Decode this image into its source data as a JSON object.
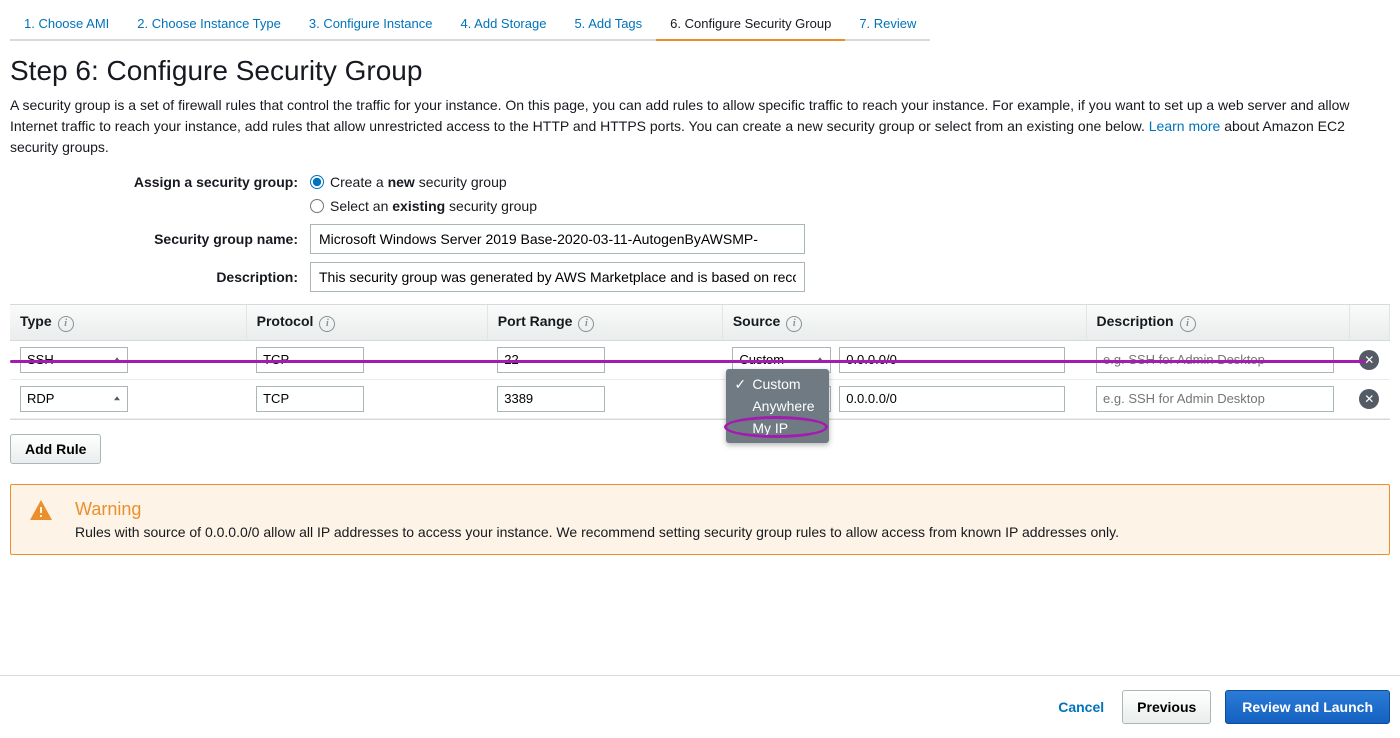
{
  "tabs": [
    "1. Choose AMI",
    "2. Choose Instance Type",
    "3. Configure Instance",
    "4. Add Storage",
    "5. Add Tags",
    "6. Configure Security Group",
    "7. Review"
  ],
  "active_tab_index": 5,
  "heading": "Step 6: Configure Security Group",
  "description_a": "A security group is a set of firewall rules that control the traffic for your instance. On this page, you can add rules to allow specific traffic to reach your instance. For example, if you want to set up a web server and allow Internet traffic to reach your instance, add rules that allow unrestricted access to the HTTP and HTTPS ports. You can create a new security group or select from an existing one below. ",
  "learn_more": "Learn more",
  "description_b": " about Amazon EC2 security groups.",
  "assign_label": "Assign a security group:",
  "radio_create_a": "Create a ",
  "radio_create_b": "new",
  "radio_create_c": " security group",
  "radio_select_a": "Select an ",
  "radio_select_b": "existing",
  "radio_select_c": " security group",
  "sg_name_label": "Security group name:",
  "sg_name_value": "Microsoft Windows Server 2019 Base-2020-03-11-AutogenByAWSMP-",
  "sg_desc_label": "Description:",
  "sg_desc_value": "This security group was generated by AWS Marketplace and is based on recomm",
  "columns": {
    "type": "Type",
    "protocol": "Protocol",
    "port": "Port Range",
    "source": "Source",
    "description": "Description"
  },
  "rows": [
    {
      "type": "SSH",
      "protocol": "TCP",
      "port": "22",
      "source_mode": "Custom",
      "source_cidr": "0.0.0.0/0",
      "desc_placeholder": "e.g. SSH for Admin Desktop"
    },
    {
      "type": "RDP",
      "protocol": "TCP",
      "port": "3389",
      "source_mode": "Custom",
      "source_cidr": "0.0.0.0/0",
      "desc_placeholder": "e.g. SSH for Admin Desktop"
    }
  ],
  "dropdown_options": [
    "Custom",
    "Anywhere",
    "My IP"
  ],
  "add_rule": "Add Rule",
  "warning": {
    "title": "Warning",
    "body": "Rules with source of 0.0.0.0/0 allow all IP addresses to access your instance. We recommend setting security group rules to allow access from known IP addresses only."
  },
  "footer": {
    "cancel": "Cancel",
    "previous": "Previous",
    "review": "Review and Launch"
  }
}
